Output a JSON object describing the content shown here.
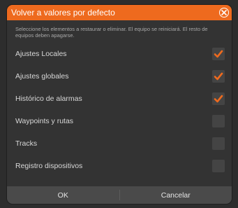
{
  "dialog": {
    "title": "Volver a valores por defecto",
    "description": "Seleccione los elementos a restaurar o eliminar. El equipo se reiniciará. El resto de equipos deben apagarse.",
    "items": [
      {
        "label": "Ajustes Locales",
        "checked": true
      },
      {
        "label": "Ajustes globales",
        "checked": true
      },
      {
        "label": "Histórico de alarmas",
        "checked": true
      },
      {
        "label": "Waypoints y rutas",
        "checked": false
      },
      {
        "label": "Tracks",
        "checked": false
      },
      {
        "label": "Registro dispositivos",
        "checked": false
      }
    ],
    "ok_label": "OK",
    "cancel_label": "Cancelar"
  },
  "colors": {
    "accent": "#ee6a1e",
    "background": "#333333",
    "footer": "#4a4a4a"
  },
  "icons": {
    "close": "close-icon",
    "check": "checkmark-icon"
  }
}
